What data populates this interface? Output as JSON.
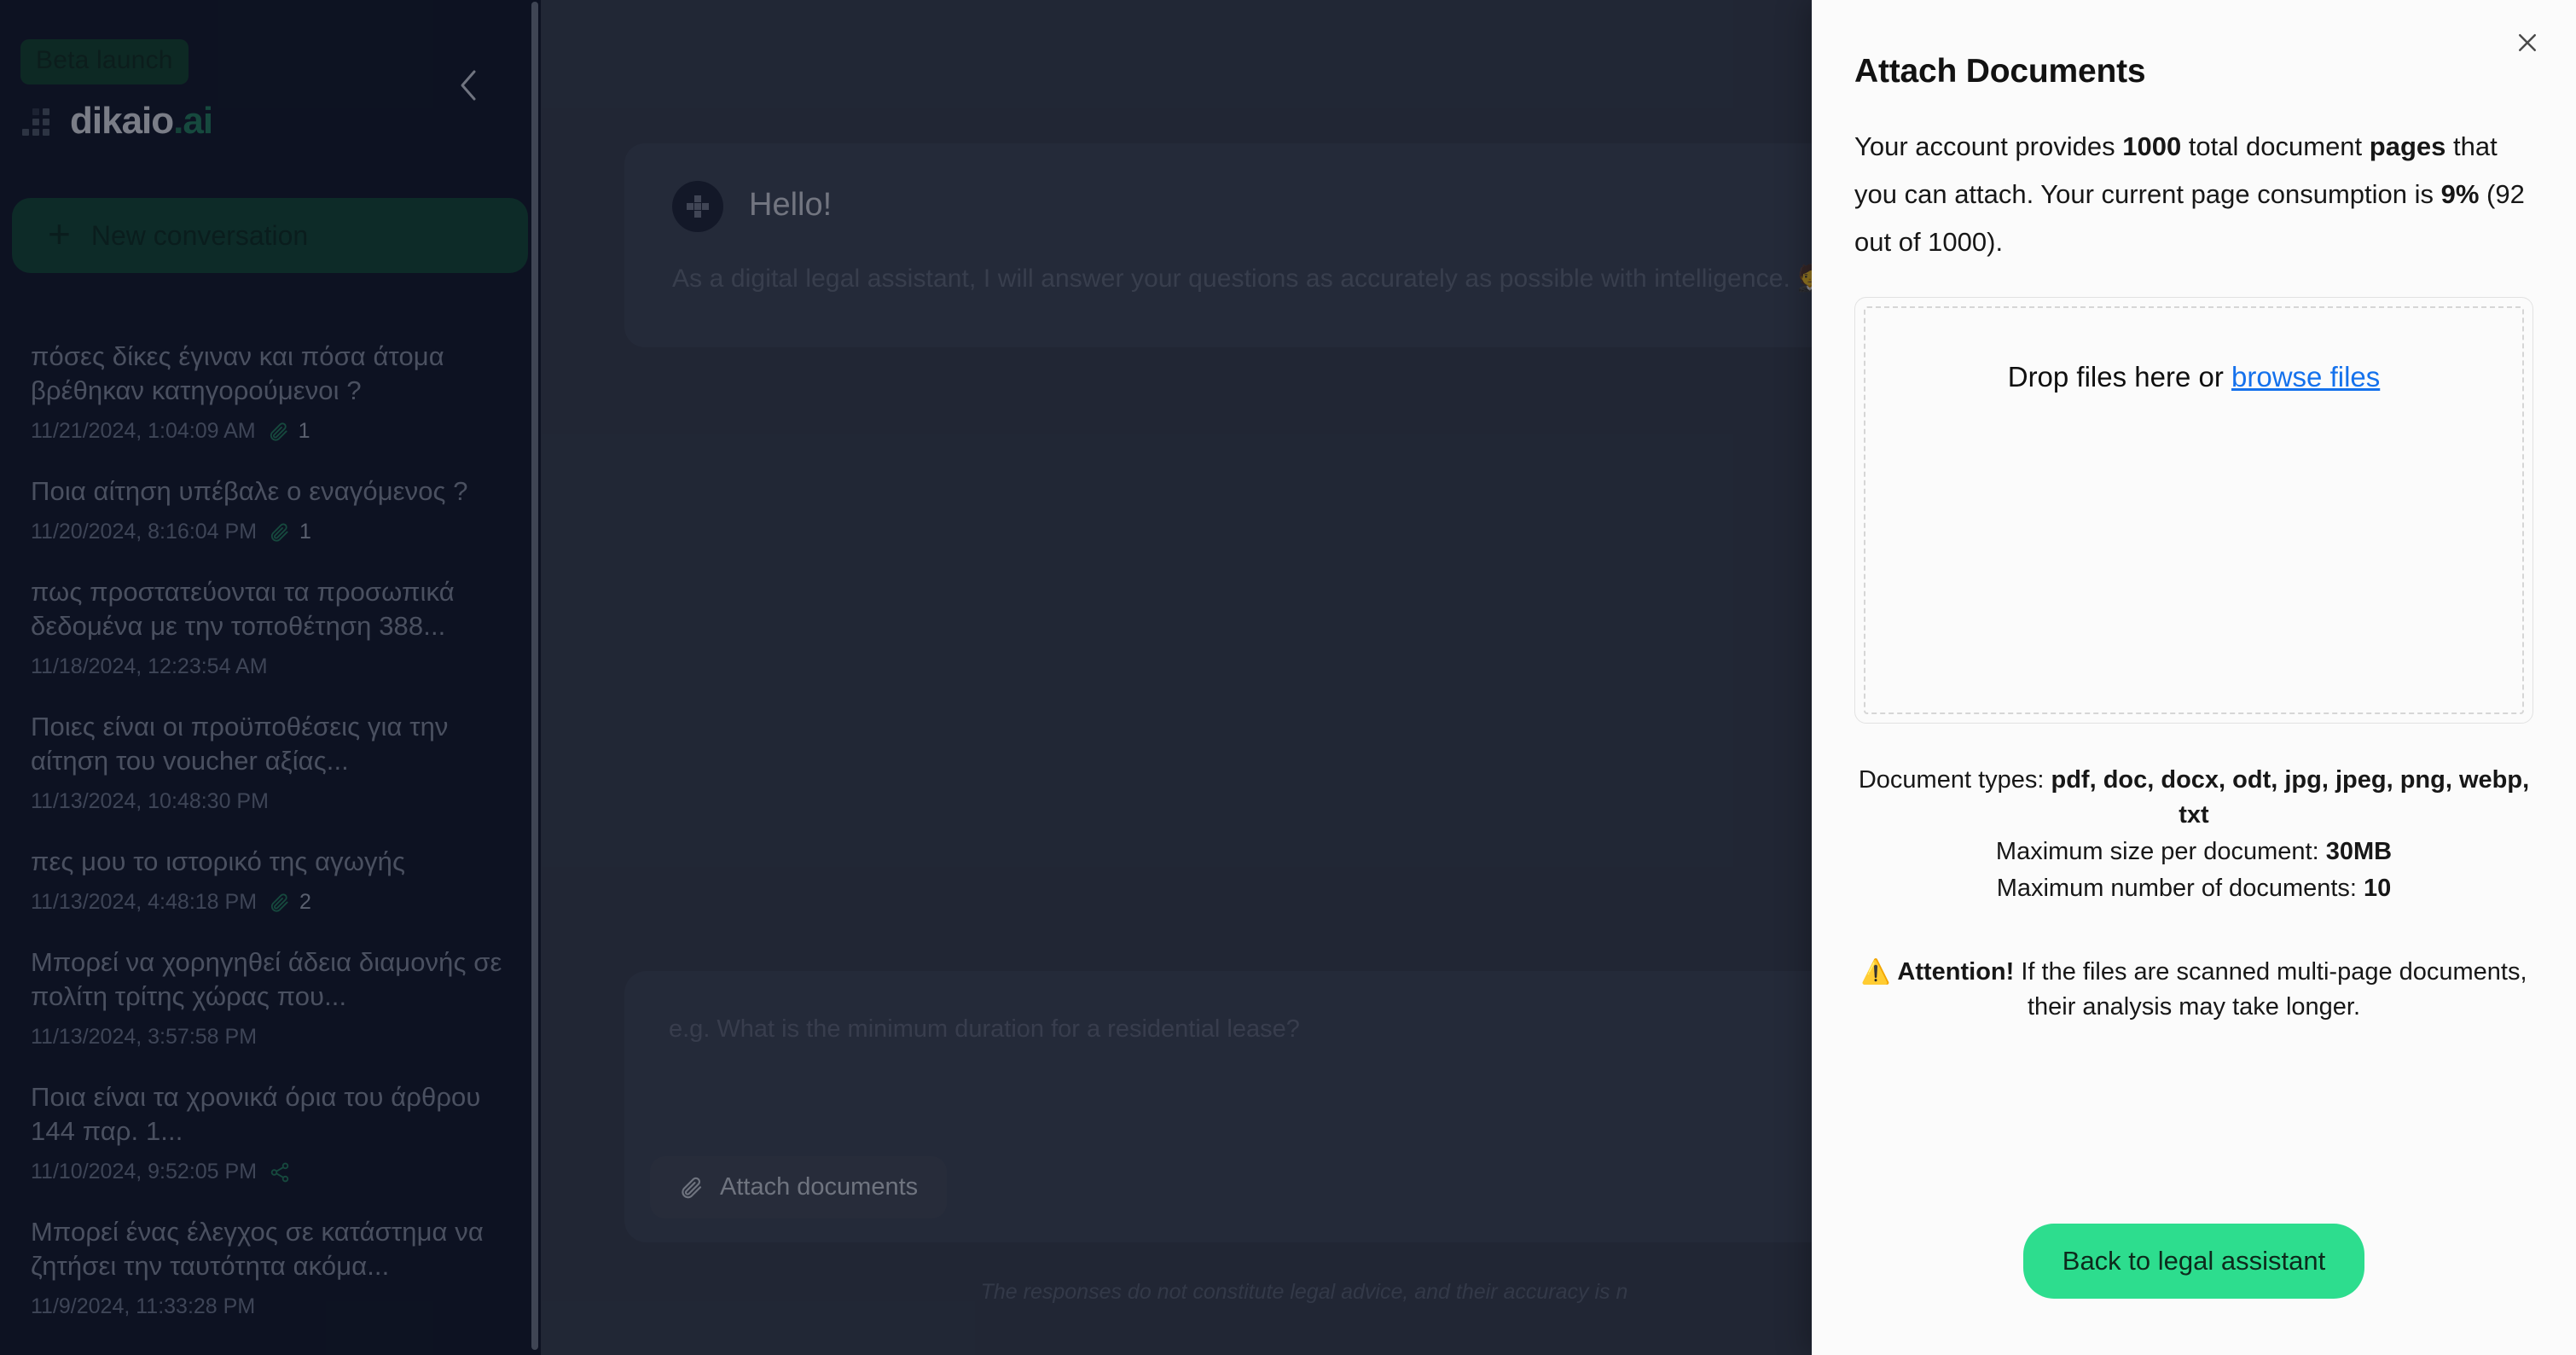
{
  "sidebar": {
    "beta_badge": "Beta launch",
    "logo_name": "dikaio",
    "logo_dot": ".",
    "logo_suffix": "ai",
    "collapse_icon": "chevron-left-icon",
    "new_conversation": {
      "label": "New conversation",
      "icon": "plus-icon"
    },
    "conversations": [
      {
        "title": "πόσες δίκες έγιναν και πόσα άτομα βρέθηκαν κατηγορούμενοι ?",
        "timestamp": "11/21/2024, 1:04:09 AM",
        "icon": "paperclip-icon",
        "count": "1"
      },
      {
        "title": "Ποια αίτηση υπέβαλε ο εναγόμενος ?",
        "timestamp": "11/20/2024, 8:16:04 PM",
        "icon": "paperclip-icon",
        "count": "1"
      },
      {
        "title": "πως προστατεύονται τα προσωπικά δεδομένα με την τοποθέτηση 388...",
        "timestamp": "11/18/2024, 12:23:54 AM",
        "icon": "",
        "count": ""
      },
      {
        "title": "Ποιες είναι οι προϋποθέσεις για την αίτηση του voucher αξίας...",
        "timestamp": "11/13/2024, 10:48:30 PM",
        "icon": "",
        "count": ""
      },
      {
        "title": "πες μου το ιστορικό της αγωγής",
        "timestamp": "11/13/2024, 4:48:18 PM",
        "icon": "paperclip-icon",
        "count": "2"
      },
      {
        "title": "Μπορεί να χορηγηθεί άδεια διαμονής σε πολίτη τρίτης χώρας που...",
        "timestamp": "11/13/2024, 3:57:58 PM",
        "icon": "",
        "count": ""
      },
      {
        "title": "Ποια είναι τα χρονικά όρια του άρθρου 144 παρ. 1...",
        "timestamp": "11/10/2024, 9:52:05 PM",
        "icon": "share-icon",
        "count": ""
      },
      {
        "title": "Μπορεί ένας έλεγχος σε κατάστημα να ζητήσει την ταυτότητα ακόμα...",
        "timestamp": "11/9/2024, 11:33:28 PM",
        "icon": "",
        "count": ""
      }
    ]
  },
  "chat": {
    "avatar_icon": "dikaio-logo-icon",
    "greeting_title": "Hello!",
    "greeting_body": "As a digital legal assistant, I will answer your questions as accurately as possible with intelligence. 🧑‍⚖️🤖",
    "composer_placeholder": "e.g. What is the minimum duration for a residential lease?",
    "composer_value": "",
    "attach_button": {
      "label": "Attach documents",
      "icon": "paperclip-icon"
    },
    "disclaimer": "The responses do not constitute legal advice, and their accuracy is n"
  },
  "panel": {
    "title": "Attach Documents",
    "close_icon": "close-icon",
    "description": {
      "part1": "Your account provides ",
      "total_pages": "1000",
      "part2": " total document ",
      "pages_word": "pages",
      "part3": " that you can attach. Your current page consumption is ",
      "percent": "9%",
      "part4": " (92 out of 1000)."
    },
    "dropzone": {
      "text": "Drop files here or ",
      "link": "browse files"
    },
    "info": {
      "types_label": "Document types: ",
      "types_value": "pdf, doc, docx, odt, jpg, jpeg, png, webp, txt",
      "size_label": "Maximum size per document: ",
      "size_value": "30MB",
      "count_label": "Maximum number of documents: ",
      "count_value": "10"
    },
    "attention": {
      "emoji": "⚠️",
      "bold": "Attention!",
      "text": " If the files are scanned multi-page documents, their analysis may take longer."
    },
    "back_button": "Back to legal assistant"
  },
  "colors": {
    "accent_green": "#2ddd8e",
    "sidebar_bg": "#10172a",
    "chat_bg": "#343b4c",
    "link_blue": "#1471ec"
  }
}
